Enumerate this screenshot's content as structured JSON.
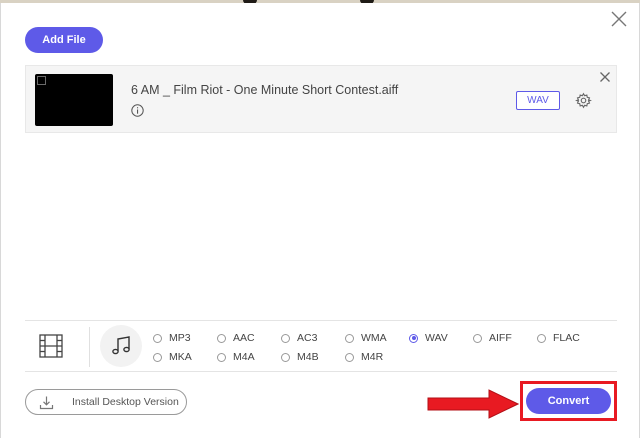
{
  "toolbar": {
    "add_file_label": "Add File"
  },
  "file": {
    "name": "6 AM _ Film Riot - One Minute Short Contest.aiff",
    "output_format": "WAV"
  },
  "formats": {
    "selected": "WAV",
    "options": [
      "MP3",
      "AAC",
      "AC3",
      "WMA",
      "WAV",
      "AIFF",
      "FLAC",
      "MKA",
      "M4A",
      "M4B",
      "M4R"
    ]
  },
  "footer": {
    "install_label": "Install Desktop Version",
    "convert_label": "Convert"
  },
  "colors": {
    "accent": "#5e5ae8",
    "highlight": "#e81a22"
  },
  "icons": [
    "close-icon",
    "info-icon",
    "gear-icon",
    "film-icon",
    "music-note-icon",
    "download-icon",
    "arrow-icon"
  ]
}
